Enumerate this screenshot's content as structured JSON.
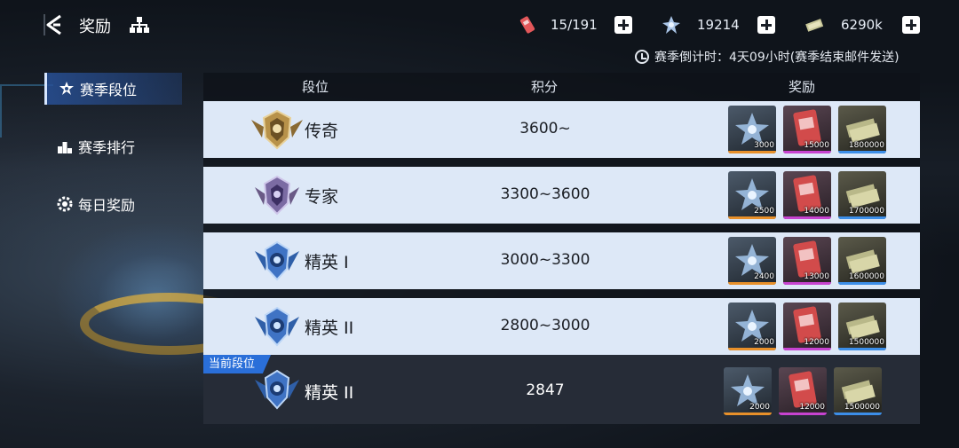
{
  "header": {
    "title": "奖励"
  },
  "resources": [
    {
      "icon": "ticket-icon",
      "value": "15/191"
    },
    {
      "icon": "crystal-icon",
      "value": "19214"
    },
    {
      "icon": "cash-icon",
      "value": "6290k"
    }
  ],
  "countdown": "赛季倒计时：4天09小时(赛季结束邮件发送)",
  "sidebar": {
    "items": [
      {
        "label": "赛季段位",
        "icon": "rank-star-icon",
        "active": true
      },
      {
        "label": "赛季排行",
        "icon": "podium-icon",
        "active": false
      },
      {
        "label": "每日奖励",
        "icon": "gear-badge-icon",
        "active": false
      }
    ]
  },
  "table": {
    "headers": {
      "rank": "段位",
      "score": "积分",
      "reward": "奖励"
    },
    "rows": [
      {
        "name": "传奇",
        "score": "3600~",
        "badge": "gold",
        "rewards": [
          "3000",
          "15000",
          "1800000"
        ]
      },
      {
        "name": "专家",
        "score": "3300~3600",
        "badge": "purple",
        "rewards": [
          "2500",
          "14000",
          "1700000"
        ]
      },
      {
        "name": "精英 I",
        "score": "3000~3300",
        "badge": "blue",
        "rewards": [
          "2400",
          "13000",
          "1600000"
        ]
      },
      {
        "name": "精英 II",
        "score": "2800~3000",
        "badge": "blue",
        "rewards": [
          "2000",
          "12000",
          "1500000"
        ]
      }
    ],
    "current": {
      "tag": "当前段位",
      "name": "精英 II",
      "score": "2847",
      "badge": "blue",
      "rewards": [
        "2000",
        "12000",
        "1500000"
      ]
    }
  },
  "colors": {
    "row_bg": "#dde8f7",
    "active_tab": "#2a6fd9",
    "crystal_bar": "#e8902a",
    "card_bar": "#c743d0",
    "cash_bar": "#3c8ee8"
  }
}
